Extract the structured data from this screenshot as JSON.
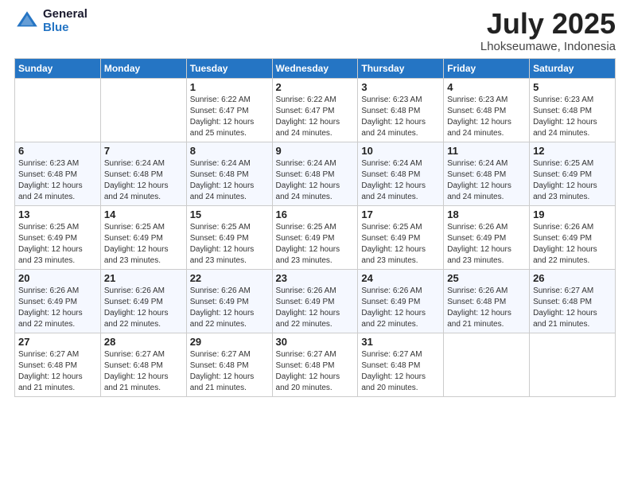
{
  "logo": {
    "general": "General",
    "blue": "Blue"
  },
  "header": {
    "month": "July 2025",
    "location": "Lhokseumawe, Indonesia"
  },
  "weekdays": [
    "Sunday",
    "Monday",
    "Tuesday",
    "Wednesday",
    "Thursday",
    "Friday",
    "Saturday"
  ],
  "weeks": [
    [
      {
        "day": "",
        "info": ""
      },
      {
        "day": "",
        "info": ""
      },
      {
        "day": "1",
        "info": "Sunrise: 6:22 AM\nSunset: 6:47 PM\nDaylight: 12 hours and 25 minutes."
      },
      {
        "day": "2",
        "info": "Sunrise: 6:22 AM\nSunset: 6:47 PM\nDaylight: 12 hours and 24 minutes."
      },
      {
        "day": "3",
        "info": "Sunrise: 6:23 AM\nSunset: 6:48 PM\nDaylight: 12 hours and 24 minutes."
      },
      {
        "day": "4",
        "info": "Sunrise: 6:23 AM\nSunset: 6:48 PM\nDaylight: 12 hours and 24 minutes."
      },
      {
        "day": "5",
        "info": "Sunrise: 6:23 AM\nSunset: 6:48 PM\nDaylight: 12 hours and 24 minutes."
      }
    ],
    [
      {
        "day": "6",
        "info": "Sunrise: 6:23 AM\nSunset: 6:48 PM\nDaylight: 12 hours and 24 minutes."
      },
      {
        "day": "7",
        "info": "Sunrise: 6:24 AM\nSunset: 6:48 PM\nDaylight: 12 hours and 24 minutes."
      },
      {
        "day": "8",
        "info": "Sunrise: 6:24 AM\nSunset: 6:48 PM\nDaylight: 12 hours and 24 minutes."
      },
      {
        "day": "9",
        "info": "Sunrise: 6:24 AM\nSunset: 6:48 PM\nDaylight: 12 hours and 24 minutes."
      },
      {
        "day": "10",
        "info": "Sunrise: 6:24 AM\nSunset: 6:48 PM\nDaylight: 12 hours and 24 minutes."
      },
      {
        "day": "11",
        "info": "Sunrise: 6:24 AM\nSunset: 6:48 PM\nDaylight: 12 hours and 24 minutes."
      },
      {
        "day": "12",
        "info": "Sunrise: 6:25 AM\nSunset: 6:49 PM\nDaylight: 12 hours and 23 minutes."
      }
    ],
    [
      {
        "day": "13",
        "info": "Sunrise: 6:25 AM\nSunset: 6:49 PM\nDaylight: 12 hours and 23 minutes."
      },
      {
        "day": "14",
        "info": "Sunrise: 6:25 AM\nSunset: 6:49 PM\nDaylight: 12 hours and 23 minutes."
      },
      {
        "day": "15",
        "info": "Sunrise: 6:25 AM\nSunset: 6:49 PM\nDaylight: 12 hours and 23 minutes."
      },
      {
        "day": "16",
        "info": "Sunrise: 6:25 AM\nSunset: 6:49 PM\nDaylight: 12 hours and 23 minutes."
      },
      {
        "day": "17",
        "info": "Sunrise: 6:25 AM\nSunset: 6:49 PM\nDaylight: 12 hours and 23 minutes."
      },
      {
        "day": "18",
        "info": "Sunrise: 6:26 AM\nSunset: 6:49 PM\nDaylight: 12 hours and 23 minutes."
      },
      {
        "day": "19",
        "info": "Sunrise: 6:26 AM\nSunset: 6:49 PM\nDaylight: 12 hours and 22 minutes."
      }
    ],
    [
      {
        "day": "20",
        "info": "Sunrise: 6:26 AM\nSunset: 6:49 PM\nDaylight: 12 hours and 22 minutes."
      },
      {
        "day": "21",
        "info": "Sunrise: 6:26 AM\nSunset: 6:49 PM\nDaylight: 12 hours and 22 minutes."
      },
      {
        "day": "22",
        "info": "Sunrise: 6:26 AM\nSunset: 6:49 PM\nDaylight: 12 hours and 22 minutes."
      },
      {
        "day": "23",
        "info": "Sunrise: 6:26 AM\nSunset: 6:49 PM\nDaylight: 12 hours and 22 minutes."
      },
      {
        "day": "24",
        "info": "Sunrise: 6:26 AM\nSunset: 6:49 PM\nDaylight: 12 hours and 22 minutes."
      },
      {
        "day": "25",
        "info": "Sunrise: 6:26 AM\nSunset: 6:48 PM\nDaylight: 12 hours and 21 minutes."
      },
      {
        "day": "26",
        "info": "Sunrise: 6:27 AM\nSunset: 6:48 PM\nDaylight: 12 hours and 21 minutes."
      }
    ],
    [
      {
        "day": "27",
        "info": "Sunrise: 6:27 AM\nSunset: 6:48 PM\nDaylight: 12 hours and 21 minutes."
      },
      {
        "day": "28",
        "info": "Sunrise: 6:27 AM\nSunset: 6:48 PM\nDaylight: 12 hours and 21 minutes."
      },
      {
        "day": "29",
        "info": "Sunrise: 6:27 AM\nSunset: 6:48 PM\nDaylight: 12 hours and 21 minutes."
      },
      {
        "day": "30",
        "info": "Sunrise: 6:27 AM\nSunset: 6:48 PM\nDaylight: 12 hours and 20 minutes."
      },
      {
        "day": "31",
        "info": "Sunrise: 6:27 AM\nSunset: 6:48 PM\nDaylight: 12 hours and 20 minutes."
      },
      {
        "day": "",
        "info": ""
      },
      {
        "day": "",
        "info": ""
      }
    ]
  ]
}
